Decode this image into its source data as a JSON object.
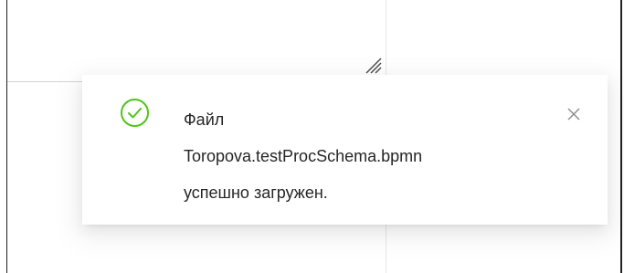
{
  "notification": {
    "type": "success",
    "icon": "check-circle-icon",
    "close_icon": "close-icon",
    "lines": [
      "Файл",
      "Toropova.testProcSchema.bpmn",
      "успешно загружен."
    ]
  },
  "colors": {
    "success": "#52c41a",
    "text": "#262626",
    "close": "#8c8c8c"
  }
}
